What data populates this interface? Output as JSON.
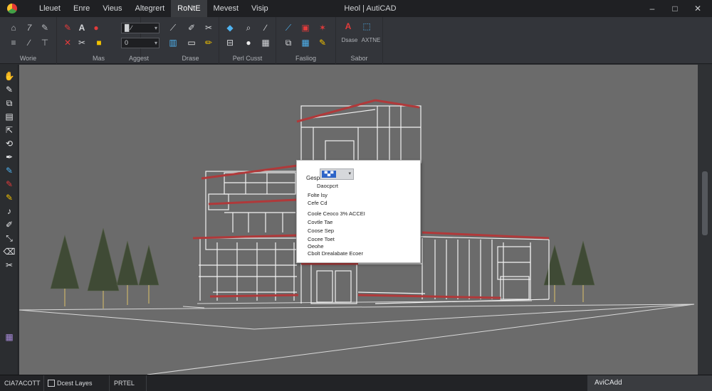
{
  "window": {
    "title": "Heol | AutiCAD",
    "minimize_glyph": "–",
    "maximize_glyph": "□",
    "close_glyph": "✕"
  },
  "menu": [
    {
      "label": "Lleuet"
    },
    {
      "label": "Enre"
    },
    {
      "label": "Vieus"
    },
    {
      "label": "Altegrert"
    },
    {
      "label": "RoNtE",
      "active": true
    },
    {
      "label": "Mevest"
    },
    {
      "label": "Visip"
    }
  ],
  "ribbon": {
    "panels": [
      {
        "title": "Worie"
      },
      {
        "title": "Mas"
      },
      {
        "title": "Aggest"
      },
      {
        "title": "Drase"
      },
      {
        "title": "Perl Cusst"
      },
      {
        "title": "Fasliog"
      },
      {
        "title": "Sabor"
      }
    ],
    "combo_1": "█ ∕",
    "combo_2": "0",
    "accent": "#e23b3b",
    "icons": [
      "home-icon",
      "italic-icon",
      "paint-icon",
      "layer-icon",
      "text-icon",
      "dim-icon",
      "delete-icon",
      "color-icon",
      "pencil-icon",
      "line-icon",
      "cut-icon",
      "gem-icon",
      "search-icon",
      "measure-icon",
      "edit-icon",
      "image-icon",
      "trim-icon",
      "text-style-icon",
      "table-icon",
      "select-icon",
      "hatch-icon",
      "grid-icon",
      "sphere-icon",
      "block-icon",
      "insert-icon"
    ],
    "small_labels": [
      "Dsase",
      "AXTNE"
    ]
  },
  "context_menu": {
    "selected": "▀▄▀",
    "items": [
      {
        "label": "Gesp"
      },
      {
        "label": "Daocpcrt"
      },
      {
        "label": "Folte lsy"
      },
      {
        "label": "Cefe Cd"
      },
      {
        "label": "Coole Ceoco 3% ACCEI"
      },
      {
        "label": "Covtle Tae"
      },
      {
        "label": "Coose Sep"
      },
      {
        "label": "Cocee Toet"
      },
      {
        "label": "Oeohe"
      },
      {
        "label": "Cbolt Drealabate Ecoer"
      }
    ]
  },
  "status": {
    "tabs": [
      "CIA7ACOTT",
      "Dcest Layes",
      "PRTEL"
    ],
    "right_label": "AviCAdd"
  },
  "colors": {
    "viewport_bg": "#6b6b6b",
    "wire": "#f2f2f2",
    "trim": "#b0393a",
    "tree": "#3f4a35"
  }
}
